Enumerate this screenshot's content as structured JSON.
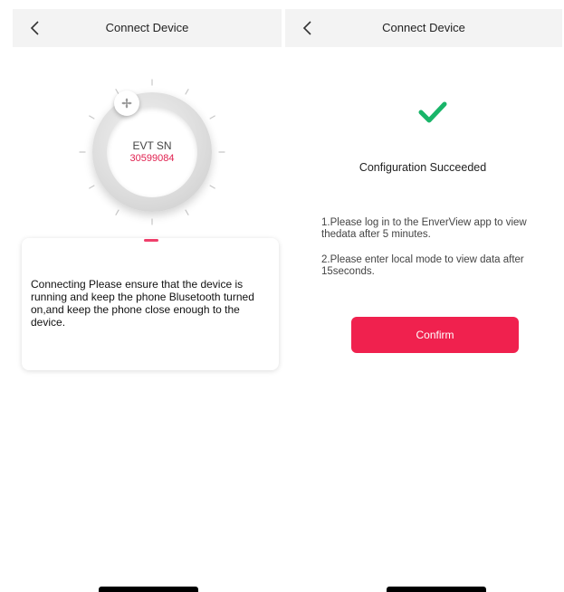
{
  "left_screen": {
    "header": {
      "title": "Connect Device",
      "back_icon": "chevron-left-icon"
    },
    "dial": {
      "label": "EVT SN",
      "serial": "30599084",
      "knob_icon": "fan-icon",
      "serial_color": "#e0204f"
    },
    "info_card": {
      "message": "Connecting Please ensure that the device is running and keep the phone Blusetooth turned on,and keep the phone close enough to the device."
    }
  },
  "right_screen": {
    "header": {
      "title": "Connect Device",
      "back_icon": "chevron-left-icon"
    },
    "status": {
      "icon": "checkmark-icon",
      "icon_color": "#19b569",
      "title": "Configuration Succeeded"
    },
    "instructions": [
      "1.Please log in to the EnverView app to view thedata after 5 minutes.",
      "2.Please enter local mode to view data after 15seconds."
    ],
    "confirm_label": "Confirm",
    "accent_color": "#f0214e"
  }
}
